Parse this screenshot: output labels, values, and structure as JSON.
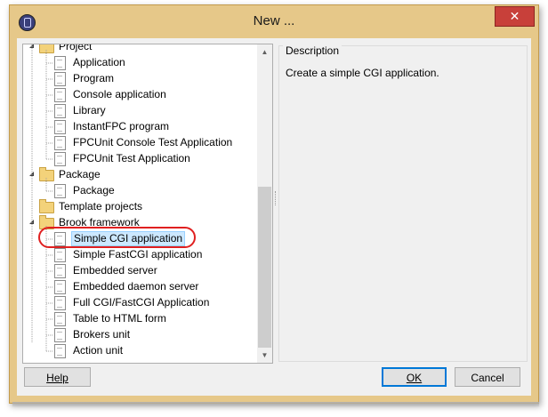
{
  "window": {
    "title": "New ...",
    "close_glyph": "✕"
  },
  "tree": {
    "nodes": [
      {
        "kind": "category",
        "label": "Project"
      },
      {
        "kind": "item",
        "label": "Application"
      },
      {
        "kind": "item",
        "label": "Program"
      },
      {
        "kind": "item",
        "label": "Console application"
      },
      {
        "kind": "item",
        "label": "Library"
      },
      {
        "kind": "item",
        "label": "InstantFPC program"
      },
      {
        "kind": "item",
        "label": "FPCUnit Console Test Application"
      },
      {
        "kind": "item",
        "label": "FPCUnit Test Application"
      },
      {
        "kind": "category",
        "label": "Package"
      },
      {
        "kind": "item",
        "label": "Package"
      },
      {
        "kind": "category-collapsed",
        "label": "Template projects"
      },
      {
        "kind": "category",
        "label": "Brook framework"
      },
      {
        "kind": "item",
        "label": "Simple CGI application",
        "selected": true
      },
      {
        "kind": "item",
        "label": "Simple FastCGI application"
      },
      {
        "kind": "item",
        "label": "Embedded server"
      },
      {
        "kind": "item",
        "label": "Embedded daemon server"
      },
      {
        "kind": "item",
        "label": "Full CGI/FastCGI Application"
      },
      {
        "kind": "item",
        "label": "Table to HTML form"
      },
      {
        "kind": "item",
        "label": "Brokers unit"
      },
      {
        "kind": "item",
        "label": "Action unit"
      }
    ]
  },
  "description": {
    "heading": "Description",
    "text": "Create a simple CGI application."
  },
  "buttons": {
    "help": "Help",
    "ok": "OK",
    "cancel": "Cancel"
  },
  "colors": {
    "title_bar": "#e6c889",
    "close_button": "#c8403a",
    "selection": "#cce8ff",
    "annotation_ring": "#e02020"
  }
}
